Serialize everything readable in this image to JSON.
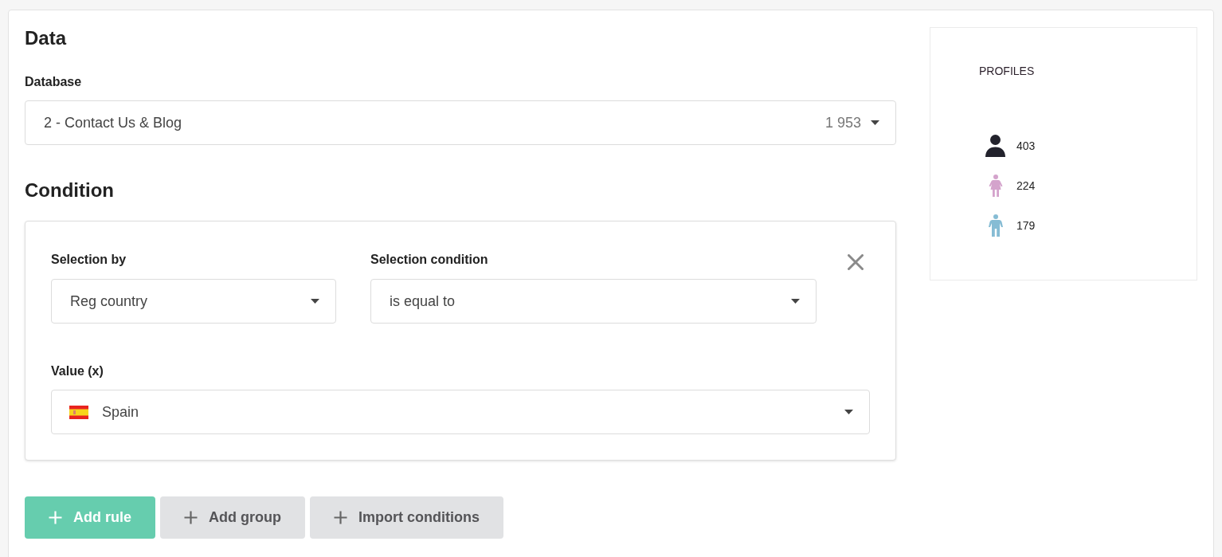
{
  "data_section": {
    "title": "Data",
    "database": {
      "label": "Database",
      "value": "2 - Contact Us & Blog",
      "count": "1 953"
    }
  },
  "condition_section": {
    "title": "Condition",
    "rule": {
      "selection_by": {
        "label": "Selection by",
        "value": "Reg country"
      },
      "selection_condition": {
        "label": "Selection condition",
        "value": "is equal to"
      },
      "value": {
        "label": "Value (x)",
        "value": "Spain"
      }
    }
  },
  "actions": [
    {
      "label": "Add rule",
      "kind": "primary"
    },
    {
      "label": "Add group",
      "kind": "secondary"
    },
    {
      "label": "Import conditions",
      "kind": "secondary"
    }
  ],
  "profiles": {
    "title": "PROFILES",
    "items": [
      {
        "kind": "all",
        "count": "403",
        "color": "#22222c"
      },
      {
        "kind": "female",
        "count": "224",
        "color": "#d4a3cc"
      },
      {
        "kind": "male",
        "count": "179",
        "color": "#86bcd4"
      }
    ]
  }
}
